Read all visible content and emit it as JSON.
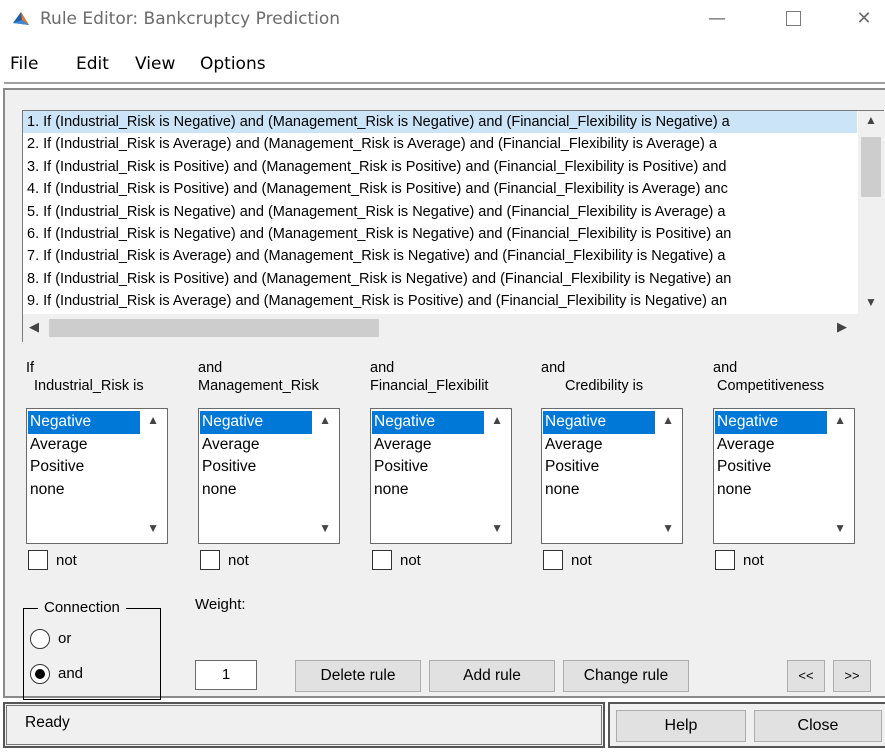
{
  "window": {
    "title": "Rule Editor: Bankcruptcy Prediction",
    "minimize_glyph": "—",
    "close_glyph": "✕",
    "icon": "matlab-icon"
  },
  "menu": {
    "file": "File",
    "edit": "Edit",
    "view": "View",
    "options": "Options"
  },
  "rules": [
    "1. If (Industrial_Risk is Negative) and (Management_Risk is Negative) and (Financial_Flexibility is Negative) a",
    "2. If (Industrial_Risk is Average) and (Management_Risk is Average) and (Financial_Flexibility is Average) a",
    "3. If (Industrial_Risk is Positive) and (Management_Risk is Positive) and (Financial_Flexibility is Positive) and",
    "4. If (Industrial_Risk is Positive) and (Management_Risk is Positive) and (Financial_Flexibility is Average) anc",
    "5. If (Industrial_Risk is Negative) and (Management_Risk is Negative) and (Financial_Flexibility is Average) a",
    "6. If (Industrial_Risk is Negative) and (Management_Risk is Negative) and (Financial_Flexibility is Positive) an",
    "7. If (Industrial_Risk is Average) and (Management_Risk is Negative) and (Financial_Flexibility is Negative) a",
    "8. If (Industrial_Risk is Positive) and (Management_Risk is Negative) and (Financial_Flexibility is Negative) an",
    "9. If (Industrial_Risk is Average) and (Management_Risk is Positive) and (Financial_Flexibility is Negative) an"
  ],
  "scroll": {
    "up": "▲",
    "down": "▼",
    "left": "◀",
    "right": "▶"
  },
  "variables": [
    {
      "line1": "If",
      "line2": "Industrial_Risk is",
      "options": [
        "Negative",
        "Average",
        "Positive",
        "none"
      ],
      "selected": "Negative",
      "not_label": "not"
    },
    {
      "line1": "and",
      "line2": "Management_Risk",
      "options": [
        "Negative",
        "Average",
        "Positive",
        "none"
      ],
      "selected": "Negative",
      "not_label": "not"
    },
    {
      "line1": "and",
      "line2": "Financial_Flexibilit",
      "options": [
        "Negative",
        "Average",
        "Positive",
        "none"
      ],
      "selected": "Negative",
      "not_label": "not"
    },
    {
      "line1": "and",
      "line2": "Credibility is",
      "options": [
        "Negative",
        "Average",
        "Positive",
        "none"
      ],
      "selected": "Negative",
      "not_label": "not"
    },
    {
      "line1": "and",
      "line2": "Competitiveness",
      "options": [
        "Negative",
        "Average",
        "Positive",
        "none"
      ],
      "selected": "Negative",
      "not_label": "not"
    }
  ],
  "connection": {
    "title": "Connection",
    "or_label": "or",
    "and_label": "and",
    "selected": "and"
  },
  "weight": {
    "label": "Weight:",
    "value": "1"
  },
  "buttons": {
    "delete_rule": "Delete rule",
    "add_rule": "Add rule",
    "change_rule": "Change rule",
    "prev": "<<",
    "next": ">>"
  },
  "status": {
    "text": "Ready"
  },
  "footer": {
    "help": "Help",
    "close": "Close"
  },
  "colors": {
    "selection": "#0078d7",
    "panel": "#f0f0f0",
    "rule_selected": "#cce4f7"
  }
}
